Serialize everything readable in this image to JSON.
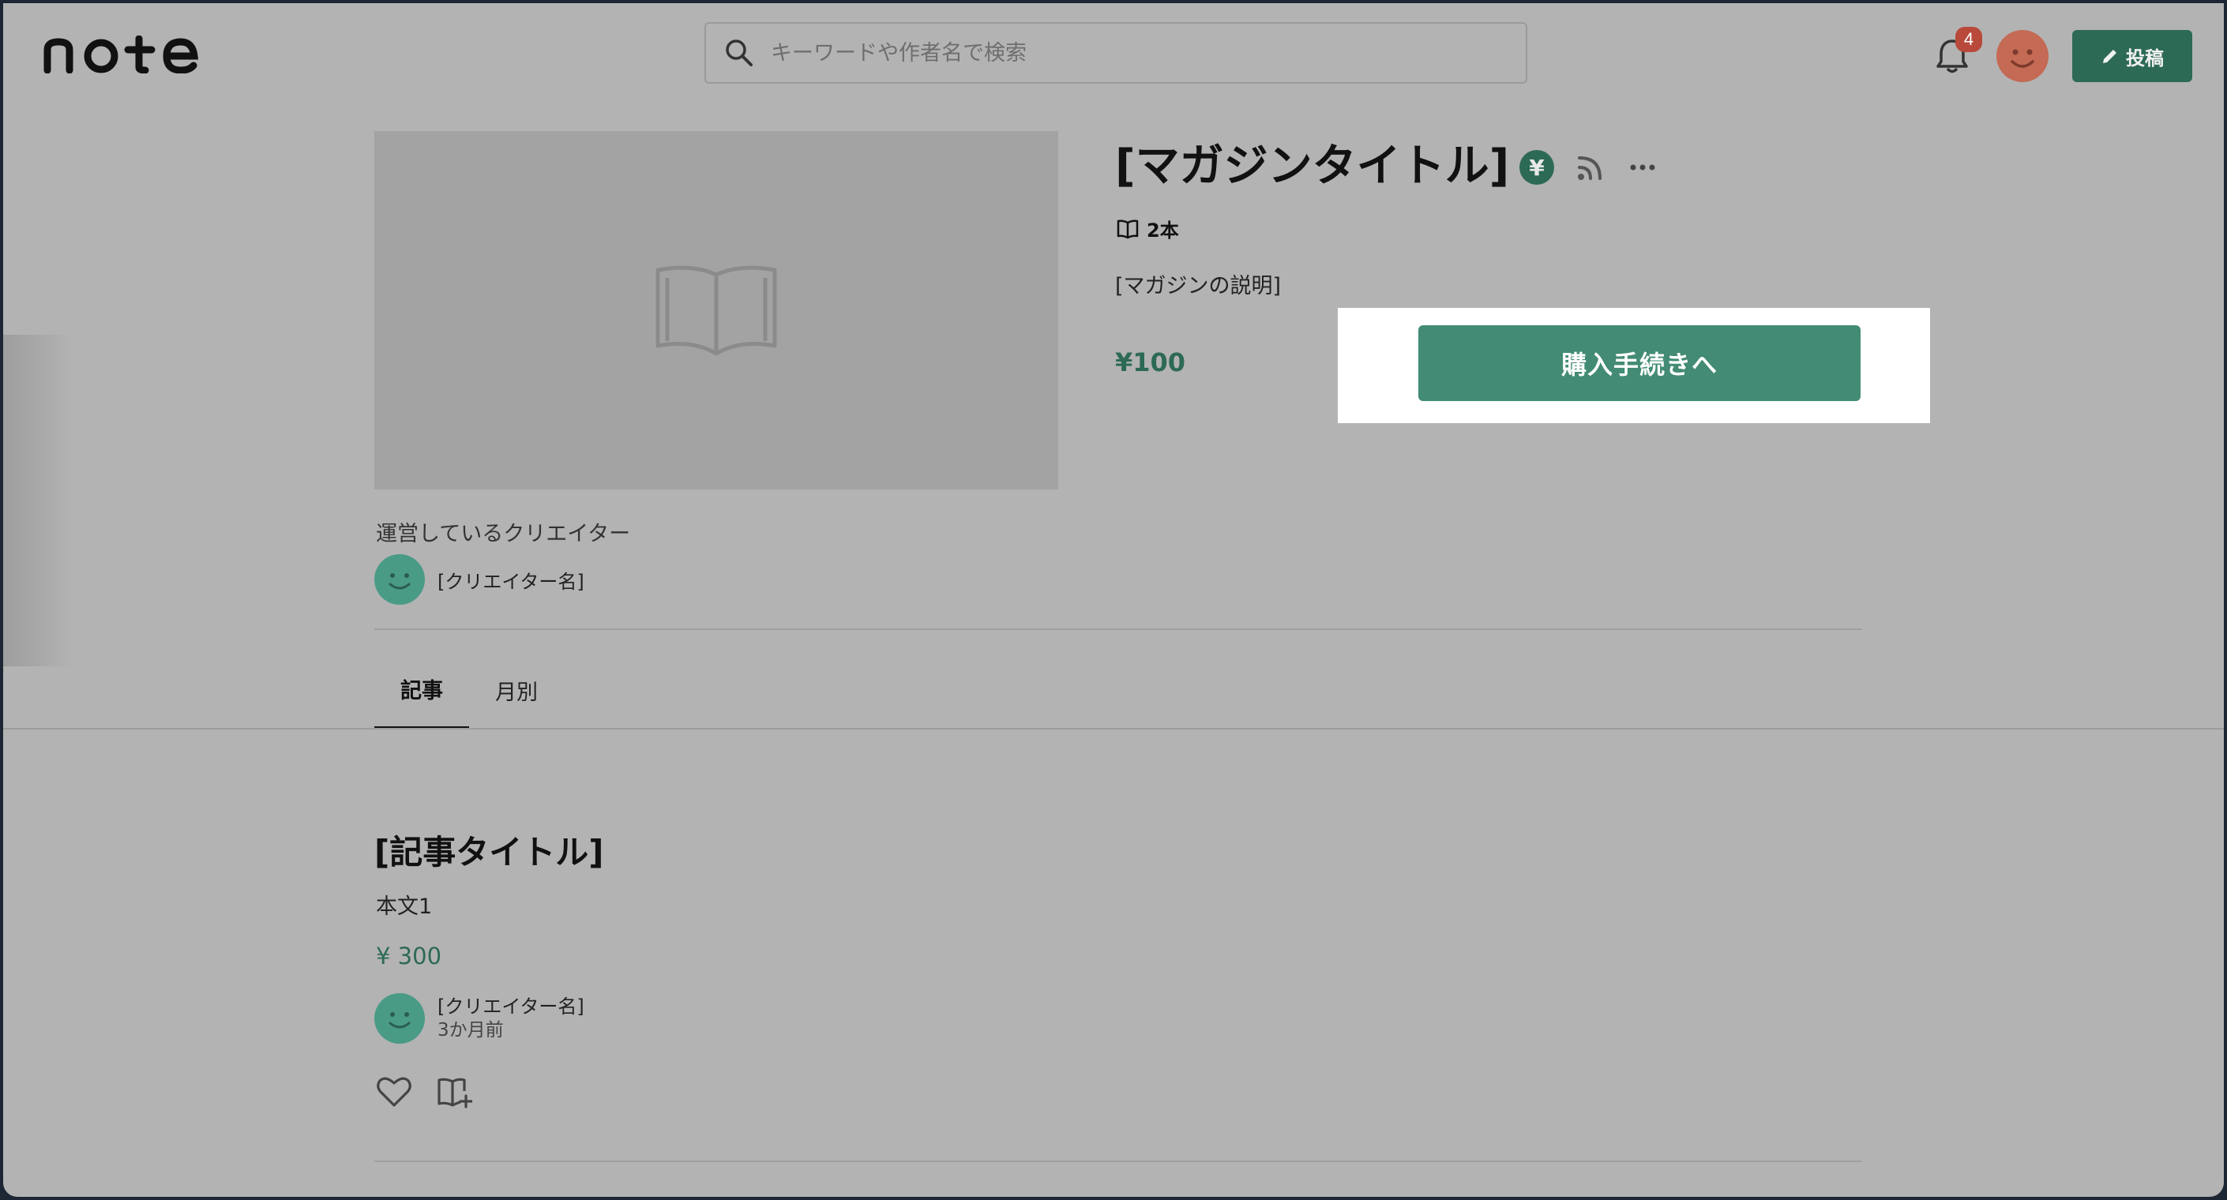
{
  "header": {
    "logo_text": "note",
    "search_placeholder": "キーワードや作者名で検索",
    "notification_count": "4",
    "post_label": "投稿"
  },
  "magazine": {
    "title": "[マガジンタイトル]",
    "yen_symbol": "¥",
    "article_count": "2本",
    "description": "[マガジンの説明]",
    "price": "¥100",
    "buy_label": "購入手続きへ",
    "creators_label": "運営しているクリエイター",
    "creator_name": "[クリエイター名]"
  },
  "tabs": [
    {
      "label": "記事",
      "active": true
    },
    {
      "label": "月別",
      "active": false
    }
  ],
  "article": {
    "title": "[記事タイトル]",
    "body": "本文1",
    "price": "¥ 300",
    "creator_name": "[クリエイター名]",
    "date": "3か月前"
  },
  "colors": {
    "brand_green": "#2d6a55",
    "button_green": "#438b74",
    "avatar_teal": "#4a9b86",
    "badge_red": "#b8493b",
    "user_avatar": "#c46a55"
  },
  "icons": [
    "search-icon",
    "bell-icon",
    "pencil-icon",
    "yen-icon",
    "rss-icon",
    "more-icon",
    "book-icon",
    "heart-icon",
    "add-to-magazine-icon"
  ]
}
